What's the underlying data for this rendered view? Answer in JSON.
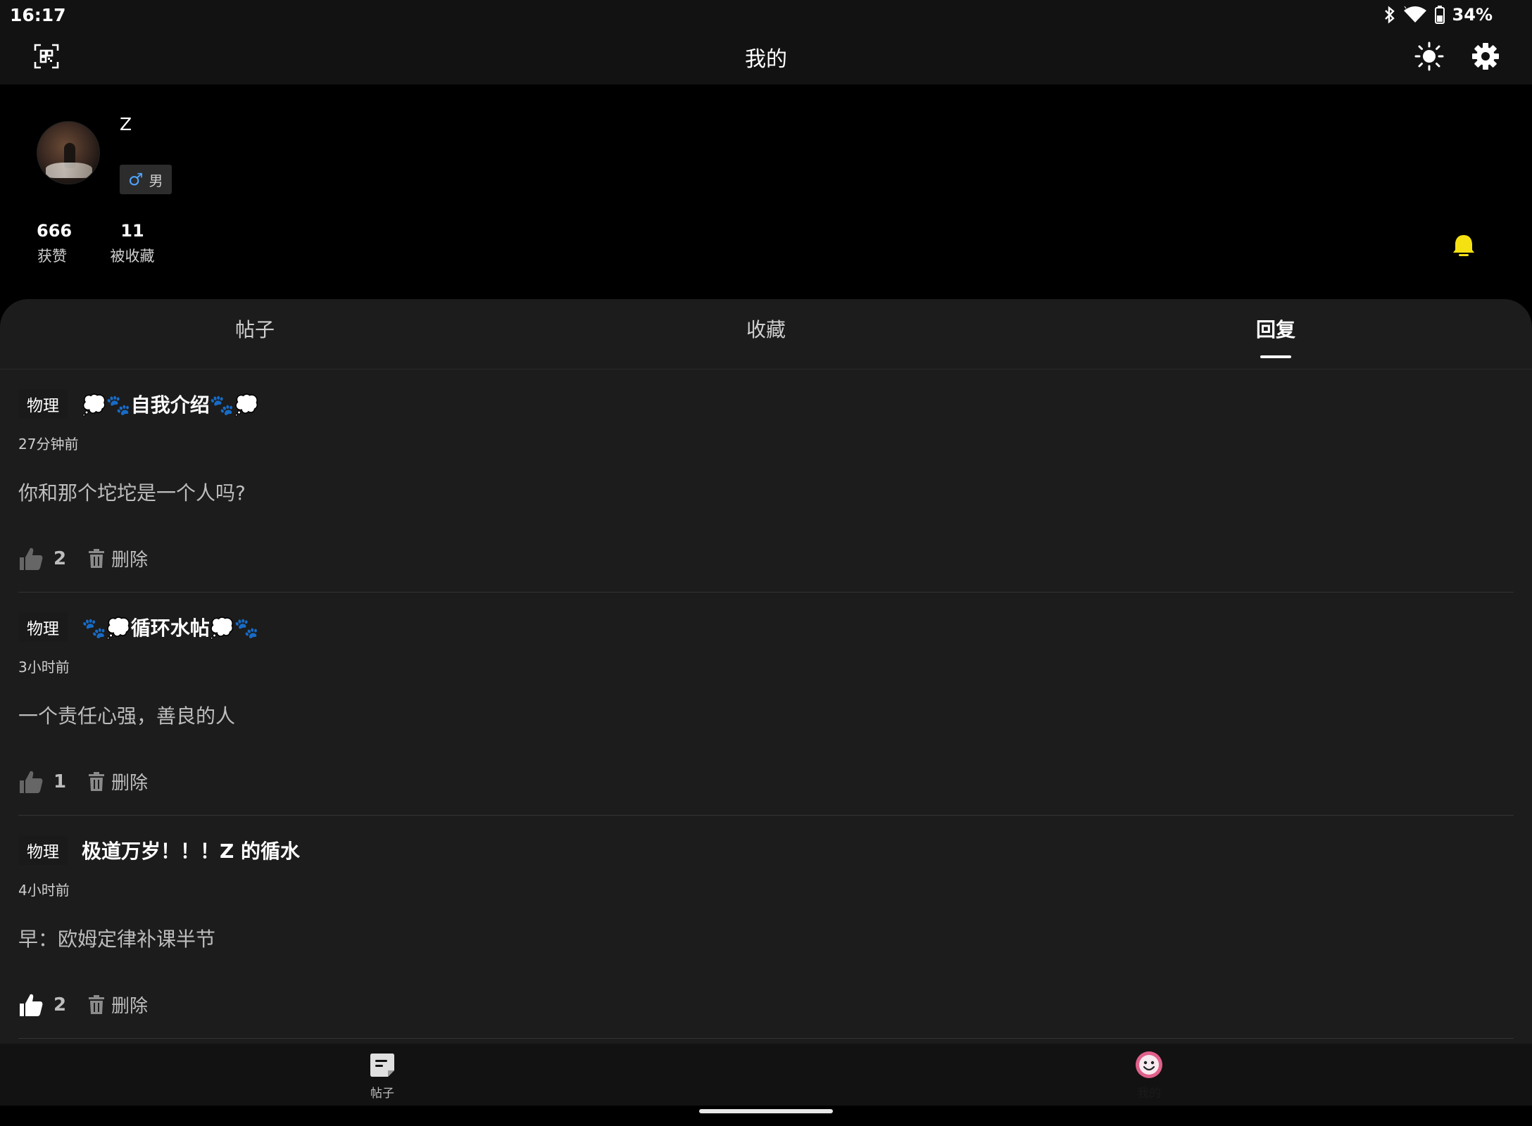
{
  "status_bar": {
    "time": "16:17",
    "battery": "34%"
  },
  "app_bar": {
    "title": "我的"
  },
  "profile": {
    "username": "Z",
    "gender_symbol": "♂",
    "gender": "男",
    "stats": [
      {
        "value": "666",
        "label": "获赞"
      },
      {
        "value": "11",
        "label": "被收藏"
      }
    ]
  },
  "tabs": [
    "帖子",
    "收藏",
    "回复"
  ],
  "active_tab": "回复",
  "replies": [
    {
      "tag": "物理",
      "title": "💭🐾自我介绍🐾💭",
      "time": "27分钟前",
      "body": "你和那个坨坨是一个人吗?",
      "likes": "2",
      "delete_label": "删除"
    },
    {
      "tag": "物理",
      "title": "🐾💭循环水帖💭🐾",
      "time": "3小时前",
      "body": "一个责任心强，善良的人",
      "likes": "1",
      "delete_label": "删除"
    },
    {
      "tag": "物理",
      "title": "极道万岁！！！Z 的循水",
      "time": "4小时前",
      "body": "早：欧姆定律补课半节",
      "likes": "2",
      "delete_label": "删除"
    }
  ],
  "bottom_nav": [
    {
      "label": "帖子",
      "icon": "post-icon"
    },
    {
      "label": "我的",
      "icon": "smiley-avatar-icon"
    }
  ],
  "colors": {
    "background": "#000000",
    "panel": "#1c1c1c",
    "bell": "#f5e112",
    "gender_accent": "#4fa3ff",
    "avatar_nav_ring": "#e0608a"
  }
}
